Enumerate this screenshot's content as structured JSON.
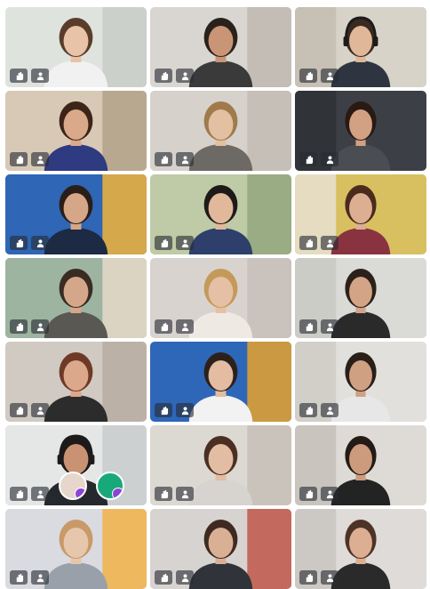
{
  "meeting": {
    "accent": "#8b7be0",
    "control_icons": [
      "hand-icon",
      "person-icon"
    ],
    "participants": [
      {
        "name": "participant-1",
        "bg": "#dfe3dd",
        "wall": "#c8ccc7",
        "hair": "#5a3c2a",
        "skin": "#e8c3a8",
        "shirt": "#f1f1f1"
      },
      {
        "name": "participant-2",
        "bg": "#d9d6d2",
        "wall": "#bfb9b1",
        "hair": "#2a211b",
        "skin": "#c99576",
        "shirt": "#3a3a3a"
      },
      {
        "name": "participant-3",
        "bg": "#d8d3c8",
        "wall": "#c4bcb0",
        "hair": "#3a2a20",
        "skin": "#e0b899",
        "shirt": "#2f3540",
        "headset": true
      },
      {
        "name": "participant-4",
        "bg": "#d8c9b7",
        "wall": "#b4a289",
        "hair": "#3d2418",
        "skin": "#d9a98a",
        "shirt": "#2e3b80"
      },
      {
        "name": "participant-5",
        "bg": "#d6d1cb",
        "wall": "#c2bcb4",
        "hair": "#a07a4a",
        "skin": "#e3c0a2",
        "shirt": "#6d6a66"
      },
      {
        "name": "participant-6",
        "bg": "#3c4046",
        "wall": "#2e3136",
        "hair": "#2a1a14",
        "skin": "#d2a184",
        "shirt": "#4a4d52"
      },
      {
        "name": "participant-7",
        "bg": "#2f66b6",
        "wall": "#f2b43a",
        "hair": "#2a1e18",
        "skin": "#d6a688",
        "shirt": "#1c2a44",
        "active": true
      },
      {
        "name": "participant-8",
        "bg": "#bfcaa6",
        "wall": "#93a77d",
        "hair": "#1e1a18",
        "skin": "#e2b89b",
        "shirt": "#2d3f6a"
      },
      {
        "name": "participant-9",
        "bg": "#d8c060",
        "wall": "#e7e1d2",
        "hair": "#4b2b1c",
        "skin": "#dcae92",
        "shirt": "#8a3340"
      },
      {
        "name": "participant-10",
        "bg": "#9db4a0",
        "wall": "#e6d9c8",
        "hair": "#3a2c22",
        "skin": "#d5a78a",
        "shirt": "#5a5853",
        "active": true
      },
      {
        "name": "participant-11",
        "bg": "#d9d3cf",
        "wall": "#c6beba",
        "hair": "#c49a5a",
        "skin": "#e6c0a4",
        "shirt": "#efe9e4"
      },
      {
        "name": "participant-12",
        "bg": "#dadad7",
        "wall": "#c9c9c4",
        "hair": "#2b201a",
        "skin": "#d3a486",
        "shirt": "#2a2a2a"
      },
      {
        "name": "participant-13",
        "bg": "#d0cac3",
        "wall": "#b7ada2",
        "hair": "#6e3a26",
        "skin": "#dca88b",
        "shirt": "#2c2c2c"
      },
      {
        "name": "participant-14",
        "bg": "#2e66b8",
        "wall": "#e5a22b",
        "hair": "#2c211a",
        "skin": "#e3bca1",
        "shirt": "#f2f2f2"
      },
      {
        "name": "participant-15",
        "bg": "#e2e0dc",
        "wall": "#cfcbc6",
        "hair": "#2a1f18",
        "skin": "#d0a083",
        "shirt": "#e7e7e7"
      },
      {
        "name": "participant-16",
        "bg": "#e5e6e6",
        "wall": "#c9cbcc",
        "hair": "#1d1a18",
        "skin": "#c99373",
        "shirt": "#25282d",
        "headset": true
      },
      {
        "name": "participant-17",
        "bg": "#dcd8d2",
        "wall": "#c7c0b8",
        "hair": "#4a3022",
        "skin": "#e3bda3",
        "shirt": "#d7d3cf"
      },
      {
        "name": "participant-18",
        "bg": "#dedbd6",
        "wall": "#c5bfb8",
        "hair": "#241b16",
        "skin": "#cc9b7e",
        "shirt": "#232323"
      },
      {
        "name": "participant-19",
        "bg": "#d9dbe0",
        "wall": "#f0b246",
        "hair": "#c79a68",
        "skin": "#e6c7ae",
        "shirt": "#9aa0aa"
      },
      {
        "name": "participant-20",
        "bg": "#d7d3d0",
        "wall": "#c0564a",
        "hair": "#3e2a20",
        "skin": "#dab095",
        "shirt": "#30333a"
      },
      {
        "name": "participant-21",
        "bg": "#dedbd8",
        "wall": "#c9c4bf",
        "hair": "#4d3226",
        "skin": "#dcae92",
        "shirt": "#2a2a2a"
      }
    ],
    "reactions": [
      {
        "name": "reaction-avatar",
        "color": "#e7d6cc"
      },
      {
        "name": "reaction-sound-wave",
        "color": "#19a87a"
      }
    ]
  }
}
